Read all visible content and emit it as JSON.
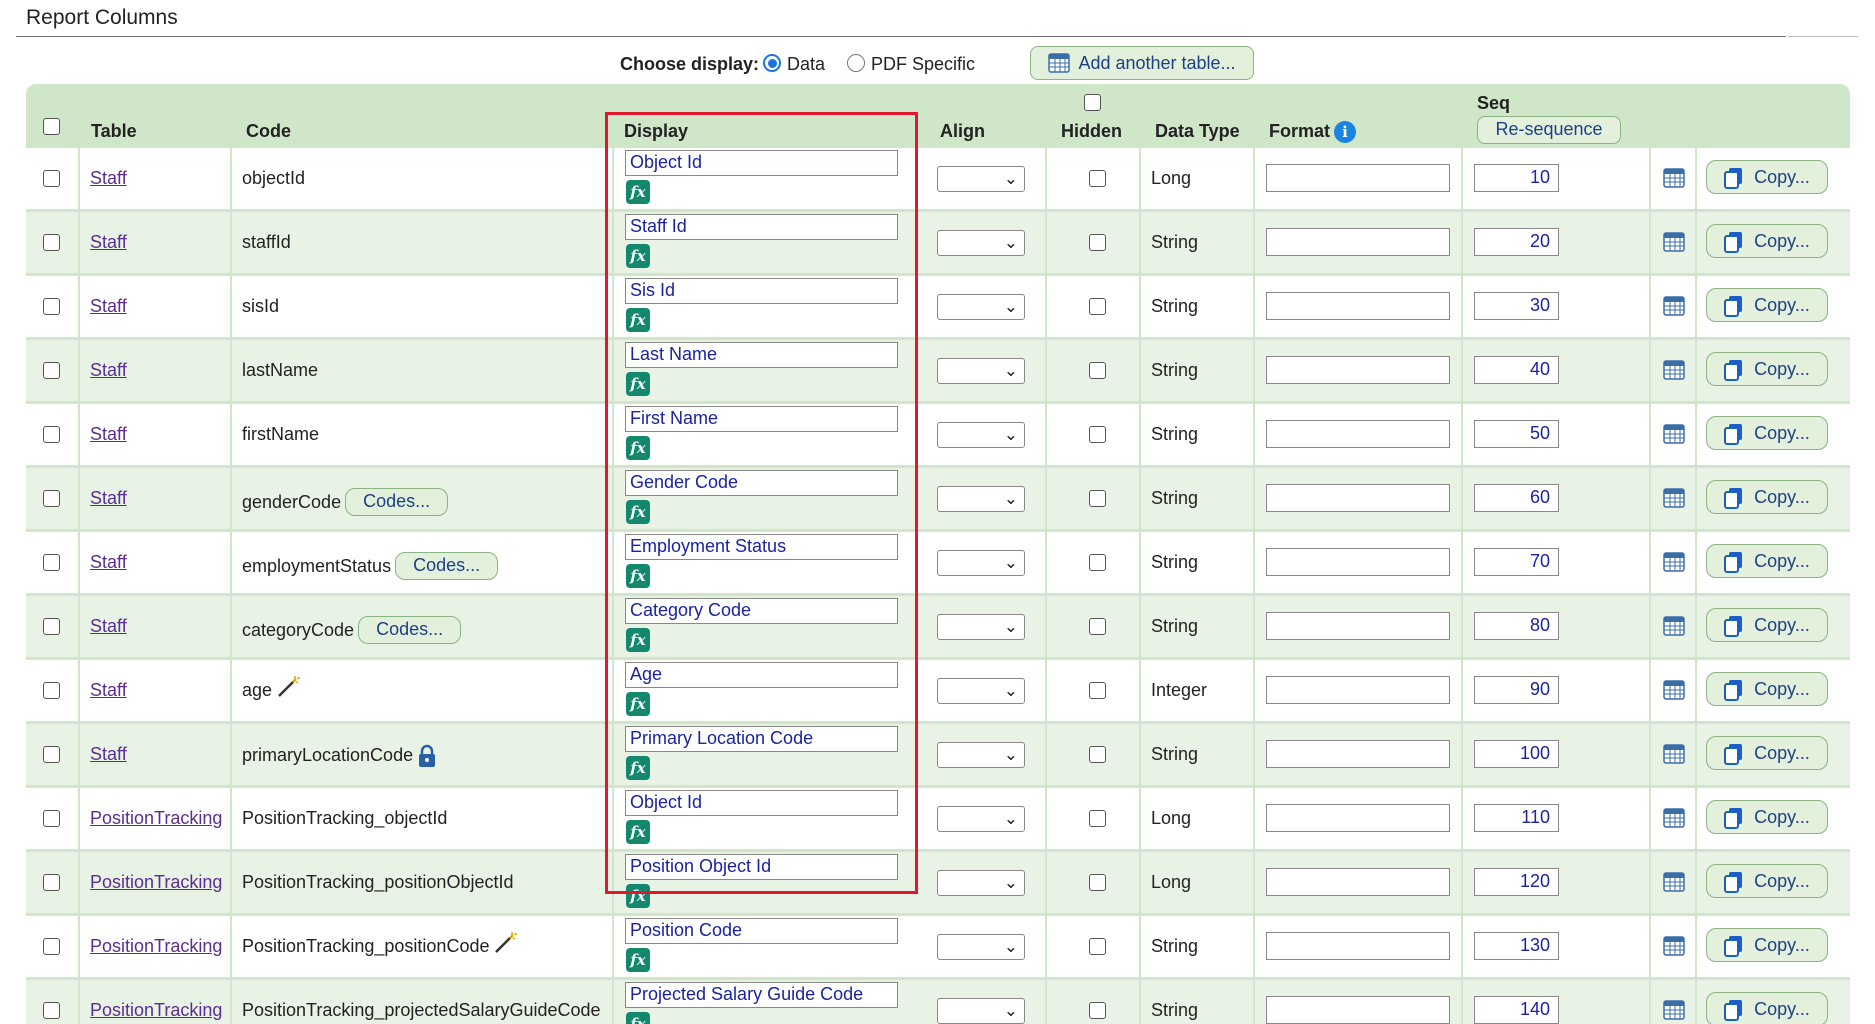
{
  "section_title": "Report Columns",
  "choose_display": {
    "label": "Choose display:",
    "options": [
      "Data",
      "PDF Specific"
    ],
    "selected": "Data",
    "add_table_label": "Add another table..."
  },
  "headers": {
    "table": "Table",
    "code": "Code",
    "display": "Display",
    "align": "Align",
    "hidden": "Hidden",
    "data_type": "Data Type",
    "format": "Format",
    "seq": "Seq",
    "resequence": "Re-sequence"
  },
  "fx_label": "fx",
  "copy_label": "Copy...",
  "codes_label": "Codes...",
  "rows": [
    {
      "table": "Staff",
      "code": "objectId",
      "display": "Object Id",
      "type": "Long",
      "seq": "10"
    },
    {
      "table": "Staff",
      "code": "staffId",
      "display": "Staff Id",
      "type": "String",
      "seq": "20"
    },
    {
      "table": "Staff",
      "code": "sisId",
      "display": "Sis Id",
      "type": "String",
      "seq": "30"
    },
    {
      "table": "Staff",
      "code": "lastName",
      "display": "Last Name",
      "type": "String",
      "seq": "40"
    },
    {
      "table": "Staff",
      "code": "firstName",
      "display": "First Name",
      "type": "String",
      "seq": "50"
    },
    {
      "table": "Staff",
      "code": "genderCode",
      "display": "Gender Code",
      "type": "String",
      "seq": "60",
      "codes": true
    },
    {
      "table": "Staff",
      "code": "employmentStatus",
      "display": "Employment Status",
      "type": "String",
      "seq": "70",
      "codes": true
    },
    {
      "table": "Staff",
      "code": "categoryCode",
      "display": "Category Code",
      "type": "String",
      "seq": "80",
      "codes": true
    },
    {
      "table": "Staff",
      "code": "age",
      "display": "Age",
      "type": "Integer",
      "seq": "90",
      "icon": "magic-wand-icon"
    },
    {
      "table": "Staff",
      "code": "primaryLocationCode",
      "display": "Primary Location Code",
      "type": "String",
      "seq": "100",
      "icon": "lock-icon"
    },
    {
      "table": "PositionTracking",
      "code": "PositionTracking_objectId",
      "display": "Object Id",
      "type": "Long",
      "seq": "110"
    },
    {
      "table": "PositionTracking",
      "code": "PositionTracking_positionObjectId",
      "display": "Position Object Id",
      "type": "Long",
      "seq": "120"
    },
    {
      "table": "PositionTracking",
      "code": "PositionTracking_positionCode",
      "display": "Position Code",
      "type": "String",
      "seq": "130",
      "icon": "magic-wand-icon"
    },
    {
      "table": "PositionTracking",
      "code": "PositionTracking_projectedSalaryGuideCode",
      "display": "Projected Salary Guide Code",
      "type": "String",
      "seq": "140"
    }
  ]
}
